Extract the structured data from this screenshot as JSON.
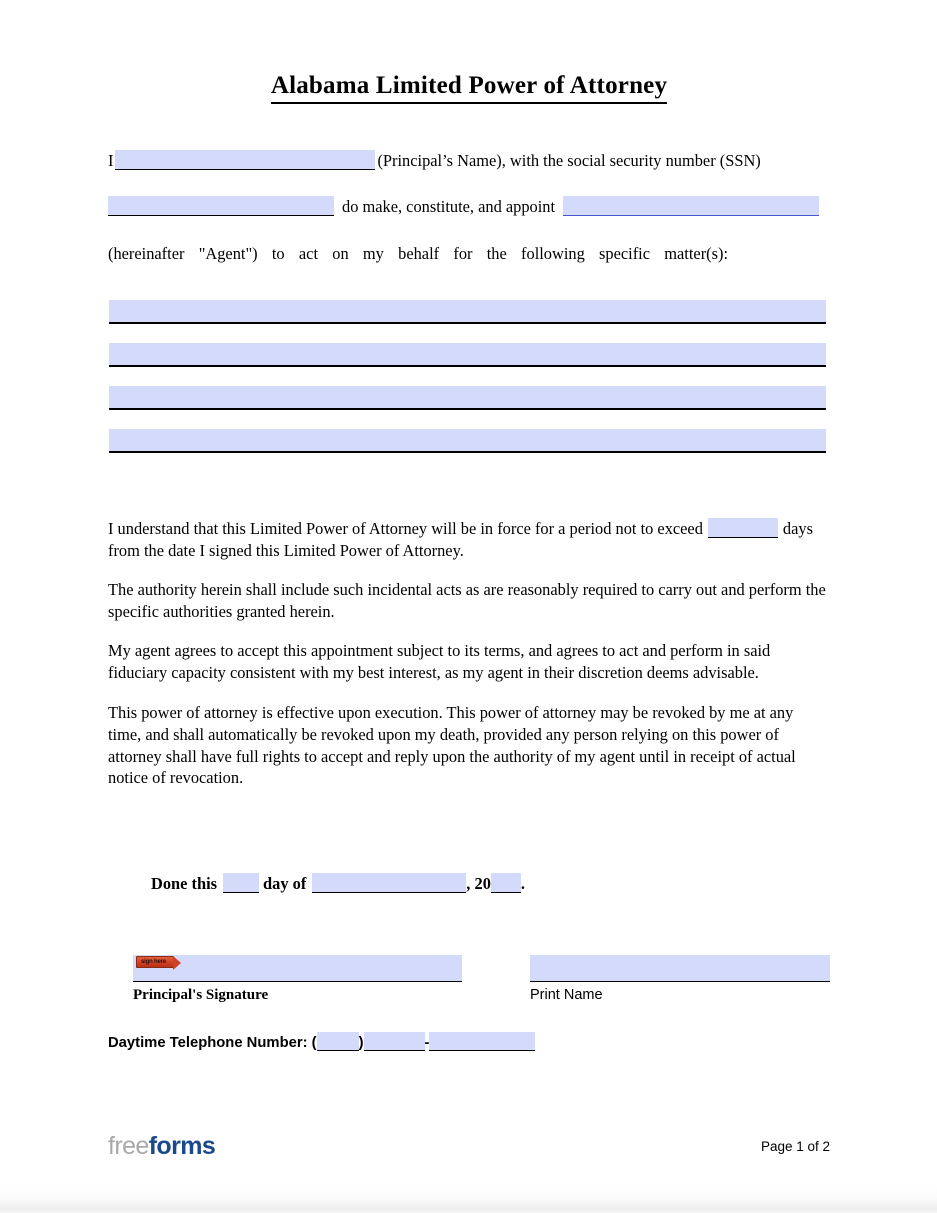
{
  "document": {
    "title": "Alabama Limited Power of Attorney"
  },
  "intro": {
    "i_label": "I",
    "principal_name_suffix": "(Principal’s Name), with the social security number (SSN)",
    "appoint_text": "do make, constitute, and appoint",
    "hereinafter_line": "(hereinafter \"Agent\") to act on my behalf for the following specific matter(s):"
  },
  "fields": {
    "principal_name": "",
    "ssn": "",
    "agent_name": "",
    "matter_1": "",
    "matter_2": "",
    "matter_3": "",
    "matter_4": "",
    "days": "",
    "done_day": "",
    "done_month": "",
    "done_year": "",
    "principal_signature": "",
    "print_name": "",
    "phone_area": "",
    "phone_prefix": "",
    "phone_line": ""
  },
  "paragraphs": {
    "duration_prefix": "I understand that this Limited Power of Attorney will be in force for a period not to exceed",
    "duration_suffix": "days",
    "duration_line2": "from the date I signed this Limited Power of Attorney.",
    "authority": "The authority herein shall include such incidental acts as are reasonably required to carry out and perform the specific authorities granted herein.",
    "agent_accept": "My agent agrees to accept this appointment subject to its terms, and agrees to act and perform in said fiduciary capacity consistent with my best interest, as my agent in their discretion deems advisable.",
    "revocation": "This power of attorney is effective upon execution. This power of attorney may be revoked by me at any time, and shall automatically be revoked upon my death, provided any person relying on this power of attorney shall have full rights to accept and reply upon the authority of my agent until in receipt of actual notice of revocation."
  },
  "execution": {
    "done_this": "Done this",
    "day_of": "day of",
    "comma_twenty": ", 20",
    "period": ".",
    "signature_caption": "Principal's Signature",
    "print_name_caption": "Print Name",
    "sign_here_tag": "sign here",
    "phone_label": "Daytime Telephone Number: (",
    "phone_close_paren": ")",
    "phone_dash": "-"
  },
  "footer": {
    "logo_part1": "free",
    "logo_part2": "forms",
    "page_number": "Page 1 of 2"
  },
  "colors": {
    "field_fill": "#d4daf9",
    "logo_gray": "#a9a9a9",
    "logo_blue": "#1b4a8c",
    "sign_tag_red": "#cf4024"
  }
}
